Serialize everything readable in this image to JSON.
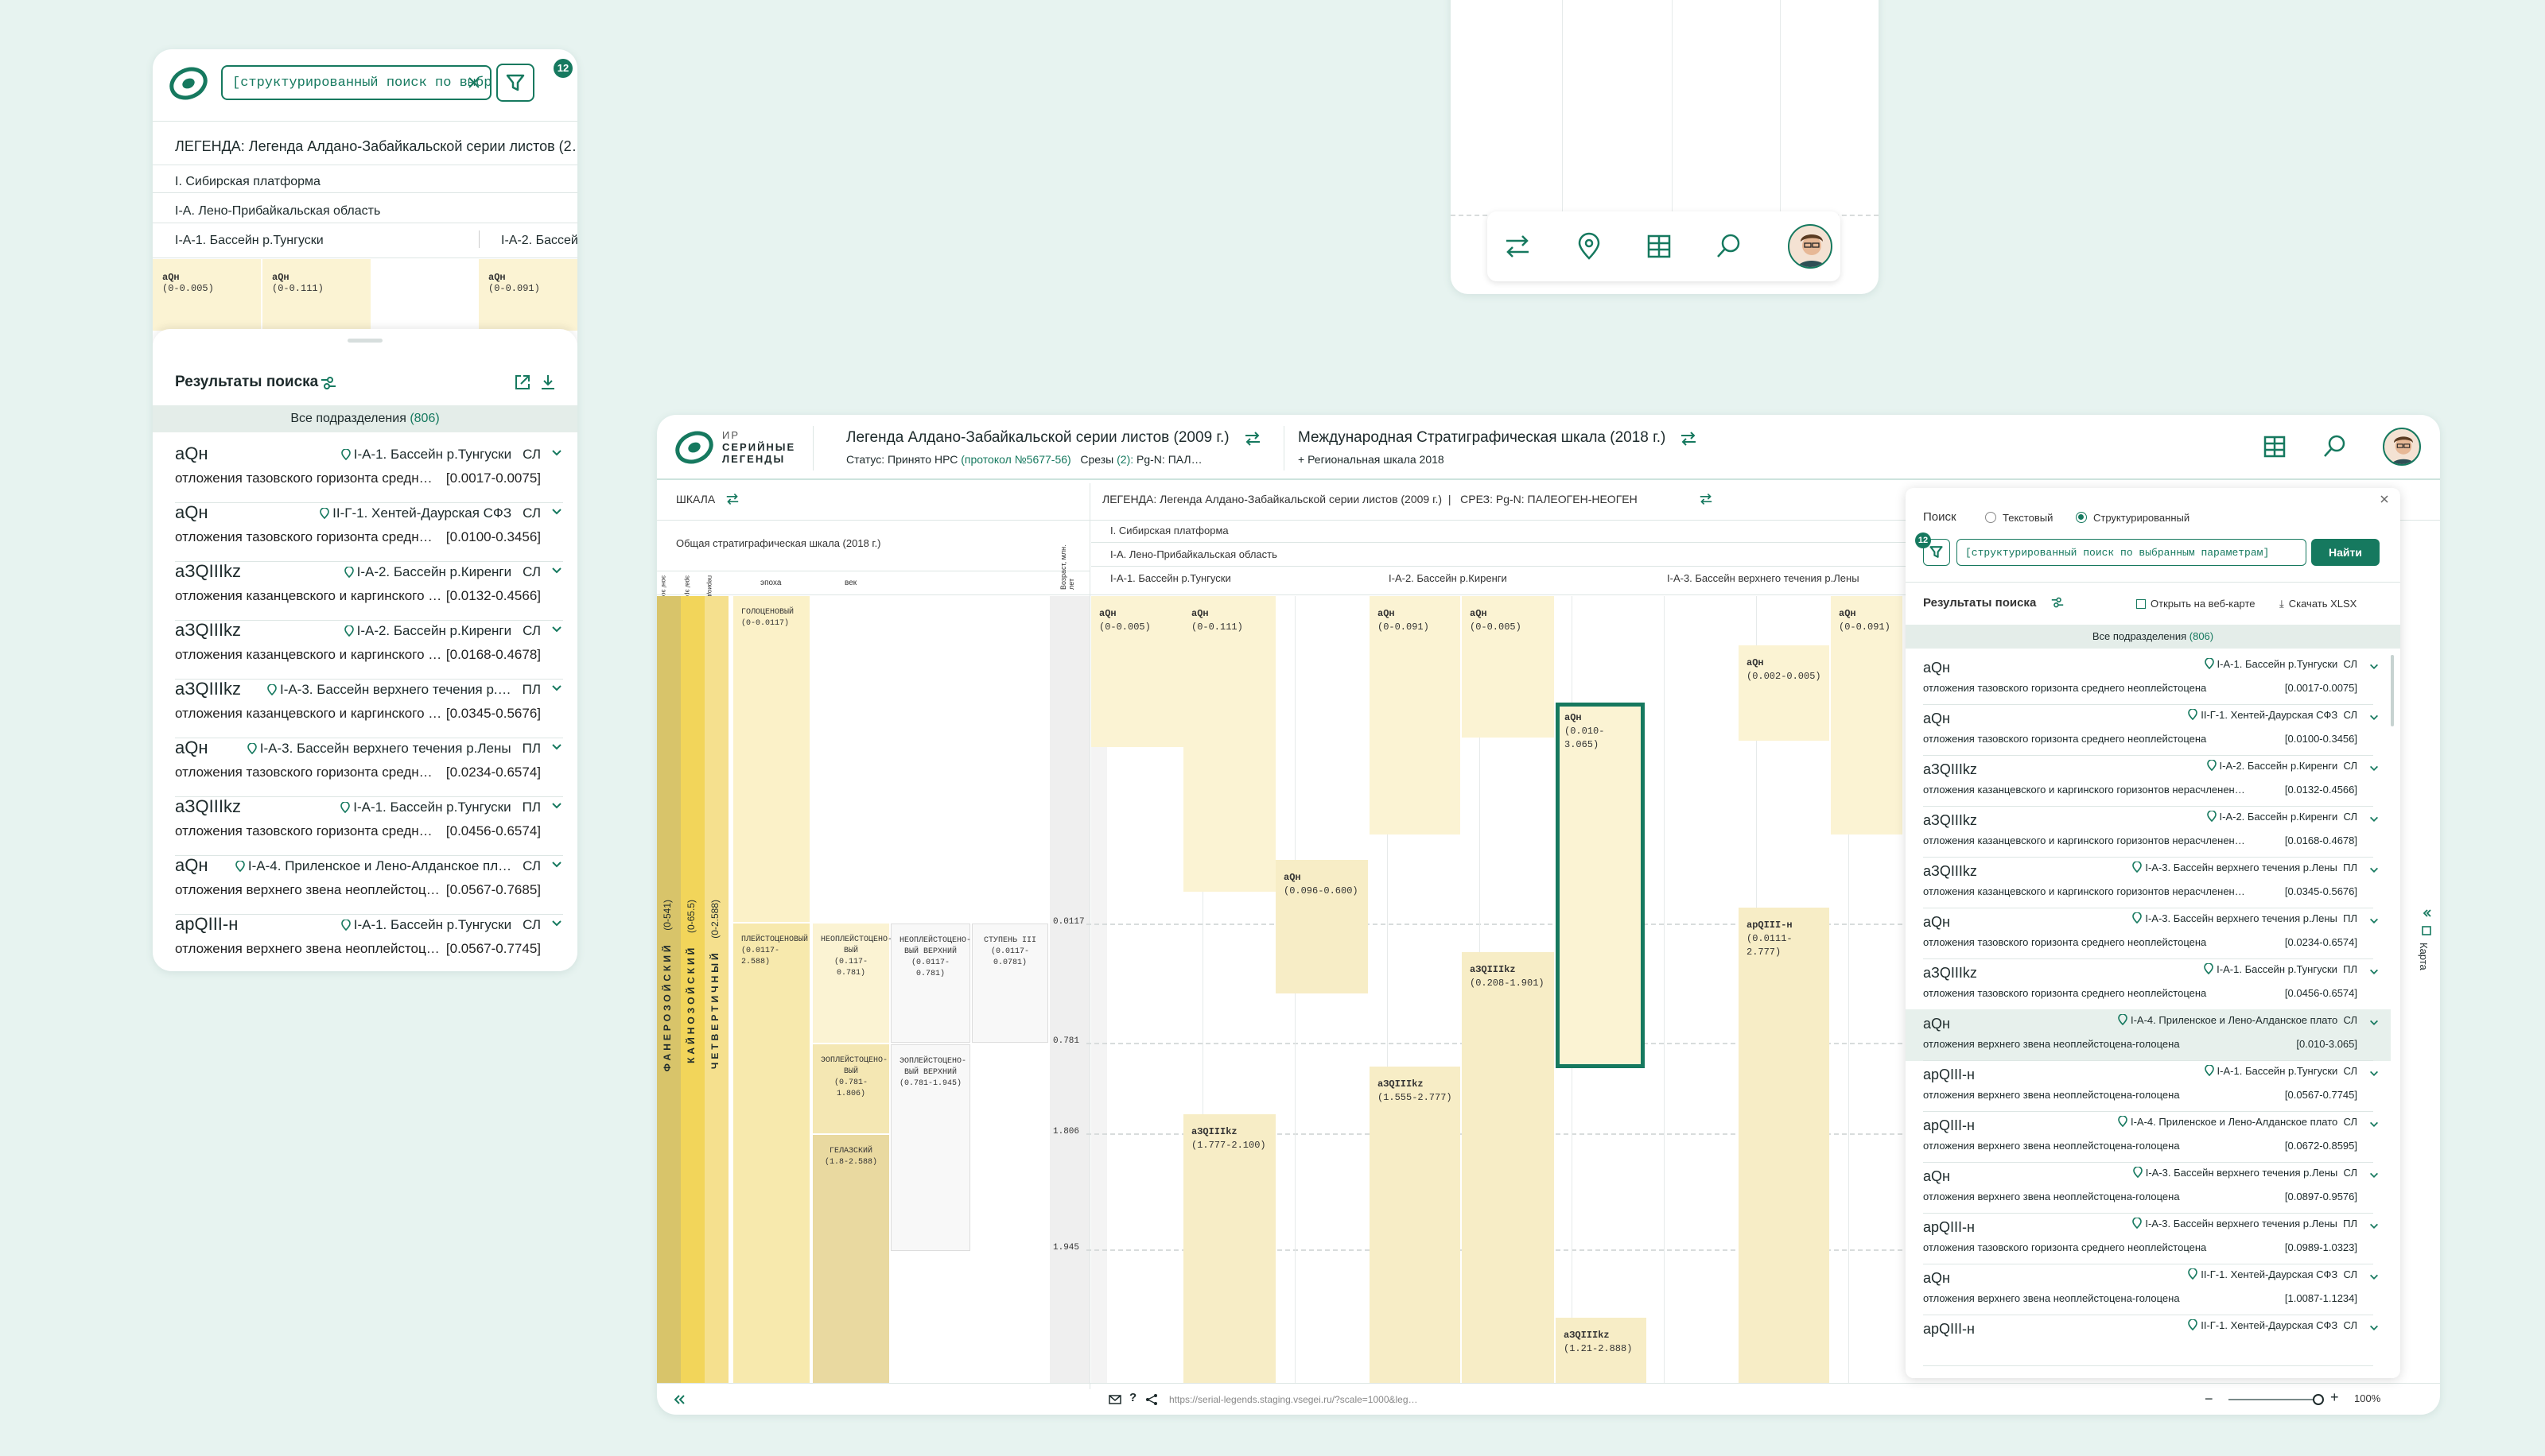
{
  "brand": {
    "line1": "ИР",
    "line2": "СЕРИЙНЫЕ",
    "line3": "ЛЕГЕНДЫ",
    "accent": "#16795f",
    "bg": "#e7f3f0",
    "cell": "#fbf3d3"
  },
  "mobile": {
    "search_value": "[структурированный поиск по выбр…",
    "filter_badge": "12",
    "legend_prefix": "ЛЕГЕНДА:",
    "legend_title": "Легенда Алдано-Забайкальской серии листов (2…",
    "region_1": "I. Сибирская платформа",
    "region_2": "I-А. Лено-Прибайкальская область",
    "basin_1": "I-А-1. Бассейн р.Тунгуски",
    "basin_2": "I-А-2. Бассей",
    "cells": [
      {
        "code": "aQн",
        "range": "(0-0.005)"
      },
      {
        "code": "aQн",
        "range": "(0-0.111)"
      },
      {
        "code": "aQн",
        "range": "(0-0.091)"
      }
    ],
    "results_title": "Результаты поиска",
    "all_units_label": "Все подразделения",
    "all_units_count": "(806)",
    "results": [
      {
        "code": "aQн",
        "loc": "I-А-1. Бассейн р.Тунгуски",
        "type": "СЛ",
        "desc": "отложения тазовского горизонта средн…",
        "range": "[0.0017-0.0075]"
      },
      {
        "code": "aQн",
        "loc": "II-Г-1. Хентей-Даурская СФЗ",
        "type": "СЛ",
        "desc": "отложения тазовского горизонта средн…",
        "range": "[0.0100-0.3456]"
      },
      {
        "code": "aЗQIIIkz",
        "loc": "I-А-2. Бассейн р.Киренги",
        "type": "СЛ",
        "desc": "отложения казанцевского и каргинского г…",
        "range": "[0.0132-0.4566]"
      },
      {
        "code": "aЗQIIIkz",
        "loc": "I-А-2. Бассейн р.Киренги",
        "type": "СЛ",
        "desc": "отложения казанцевского и каргинского г…",
        "range": "[0.0168-0.4678]"
      },
      {
        "code": "aЗQIIIkz",
        "loc": "I-А-3. Бассейн верхнего течения р.…",
        "type": "ПЛ",
        "desc": "отложения казанцевского и каргинского г…",
        "range": "[0.0345-0.5676]"
      },
      {
        "code": "aQн",
        "loc": "I-А-3. Бассейн верхнего течения р.Лены",
        "type": "ПЛ",
        "desc": "отложения тазовского горизонта средн…",
        "range": "[0.0234-0.6574]"
      },
      {
        "code": "aЗQIIIkz",
        "loc": "I-А-1. Бассейн р.Тунгуски",
        "type": "ПЛ",
        "desc": "отложения тазовского горизонта средн…",
        "range": "[0.0456-0.6574]"
      },
      {
        "code": "aQн",
        "loc": "I-А-4. Приленское и Лено-Алданское пл…",
        "type": "СЛ",
        "desc": "отложения верхнего звена неоплейстоц…",
        "range": "[0.0567-0.7685]"
      },
      {
        "code": "apQIII-н",
        "loc": "I-А-1. Бассейн р.Тунгуски",
        "type": "СЛ",
        "desc": "отложения верхнего звена неоплейстоц…",
        "range": "[0.0567-0.7745]"
      }
    ]
  },
  "desktop": {
    "legend_title": "Легенда Алдано-Забайкальской серии листов (2009 г.)",
    "status_label": "Статус:",
    "status_value": "Принято НРС",
    "protocol": "(протокол №5677-56)",
    "slices_label": "Срезы",
    "slices_count": "(2):",
    "slices_value": "Pg-N: ПАЛ…",
    "scale_title": "Международная Стратиграфическая шкала (2018 г.)",
    "scale_sub": "+ Региональная шкала 2018",
    "scale_label": "ШКАЛА",
    "legend_label": "ЛЕГЕНДА:",
    "legend_name": "Легенда Алдано-Забайкальской серии листов (2009 г.)",
    "slice_label": "СРЕЗ:",
    "slice_value": "Pg-N: ПАЛЕОГЕН-НЕОГЕН",
    "scale_name": "Общая стратиграфическая шкала (2018 г.)",
    "scale_heads": [
      "эон/ эонотема",
      "эра/ эратема",
      "период/ система",
      "эпоха",
      "век"
    ],
    "age_head": "Возраст, млн. лет",
    "region_1": "I. Сибирская платформа",
    "region_2": "I-А. Лено-Прибайкальская область",
    "basins": [
      "I-А-1. Бассейн р.Тунгуски",
      "I-А-2. Бассейн р.Киренги",
      "I-А-3. Бассейн верхнего течения р.Лены"
    ],
    "eon": "ФАНЕРОЗОЙСКИЙ",
    "eon_range": "(0-541)",
    "era": "КАЙНОЗОЙСКИЙ",
    "era_range": "(0-65.5)",
    "period": "ЧЕТВЕРТИЧНЫЙ",
    "period_range": "(0-2.588)",
    "epochs": [
      {
        "name": "ГОЛОЦЕНОВЫЙ",
        "range": "(0-0.0117)"
      },
      {
        "name": "ПЛЕЙСТОЦЕНОВЫЙ",
        "range": "(0.0117-2.588)"
      }
    ],
    "ages": [
      {
        "name": "НЕОПЛЕЙСТОЦЕНО-ВЫЙ",
        "range": "(0.117-0.781)"
      },
      {
        "name": "НЕОПЛЕЙСТОЦЕНО-ВЫЙ ВЕРХНИЙ",
        "range": "(0.0117-0.781)"
      },
      {
        "name": "СТУПЕНЬ III",
        "range": "(0.0117-0.0781)"
      },
      {
        "name": "ЭОПЛЕЙСТОЦЕНО-ВЫЙ",
        "range": "(0.781-1.806)"
      },
      {
        "name": "ЭОПЛЕЙСТОЦЕНО-ВЫЙ ВЕРХНИЙ",
        "range": "(0.781-1.945)"
      },
      {
        "name": "ГЕЛАЗСКИЙ",
        "range": "(1.8-2.588)"
      }
    ],
    "ticks": [
      "0.0117",
      "0.781",
      "1.806",
      "1.945"
    ],
    "units": [
      {
        "code": "aQн",
        "range": "(0-0.005)"
      },
      {
        "code": "aQн",
        "range": "(0-0.111)"
      },
      {
        "code": "aQн",
        "range": "(0.096-0.600)"
      },
      {
        "code": "aQн",
        "range": "(0-0.091)"
      },
      {
        "code": "aQн",
        "range": "(0-0.005)"
      },
      {
        "code": "aQн",
        "range": "(0.010-3.065)"
      },
      {
        "code": "aQн",
        "range": "(0.002-0.005)"
      },
      {
        "code": "aQн",
        "range": "(0-0.091)"
      },
      {
        "code": "aЗQIIIkz",
        "range": "(1.777-2.100)"
      },
      {
        "code": "aЗQIIIkz",
        "range": "(1.555-2.777)"
      },
      {
        "code": "aЗQIIIkz",
        "range": "(0.208-1.901)"
      },
      {
        "code": "aЗQIIIkz",
        "range": "(1.21-2.888)"
      },
      {
        "code": "apQIII-н",
        "range": "(0.0111-2.777)"
      }
    ],
    "footer_url": "https://serial-legends.staging.vsegei.ru/?scale=1000&leg…",
    "zoom": "100%",
    "map_label": "Карта",
    "search": {
      "title": "Поиск",
      "opt_text": "Текстовый",
      "opt_struct": "Структурированный",
      "value": "[структурированный поиск по выбранным параметрам]",
      "badge": "12",
      "find": "Найти",
      "results_title": "Результаты поиска",
      "open_web": "Открыть на веб-карте",
      "download": "Скачать XLSX",
      "all_units_label": "Все подразделения",
      "all_units_count": "(806)",
      "results": [
        {
          "code": "aQн",
          "loc": "I-А-1. Бассейн р.Тунгуски",
          "type": "СЛ",
          "desc": "отложения тазовского горизонта среднего неоплейстоцена",
          "range": "[0.0017-0.0075]"
        },
        {
          "code": "aQн",
          "loc": "II-Г-1. Хентей-Даурская СФЗ",
          "type": "СЛ",
          "desc": "отложения тазовского горизонта среднего неоплейстоцена",
          "range": "[0.0100-0.3456]"
        },
        {
          "code": "aЗQIIIkz",
          "loc": "I-А-2. Бассейн р.Киренги",
          "type": "СЛ",
          "desc": "отложения казанцевского и каргинского горизонтов нерасчленен…",
          "range": "[0.0132-0.4566]"
        },
        {
          "code": "aЗQIIIkz",
          "loc": "I-А-2. Бассейн р.Киренги",
          "type": "СЛ",
          "desc": "отложения казанцевского и каргинского горизонтов нерасчленен…",
          "range": "[0.0168-0.4678]"
        },
        {
          "code": "aЗQIIIkz",
          "loc": "I-А-3. Бассейн верхнего течения р.Лены",
          "type": "ПЛ",
          "desc": "отложения казанцевского и каргинского горизонтов нерасчленен…",
          "range": "[0.0345-0.5676]"
        },
        {
          "code": "aQн",
          "loc": "I-А-3. Бассейн верхнего течения р.Лены",
          "type": "ПЛ",
          "desc": "отложения тазовского горизонта среднего неоплейстоцена",
          "range": "[0.0234-0.6574]"
        },
        {
          "code": "aЗQIIIkz",
          "loc": "I-А-1. Бассейн р.Тунгуски",
          "type": "ПЛ",
          "desc": "отложения тазовского горизонта среднего неоплейстоцена",
          "range": "[0.0456-0.6574]"
        },
        {
          "code": "aQн",
          "loc": "I-А-4. Приленское и Лено-Алданское плато",
          "type": "СЛ",
          "desc": "отложения верхнего звена неоплейстоцена-голоцена",
          "range": "[0.010-3.065]"
        },
        {
          "code": "apQIII-н",
          "loc": "I-А-1. Бассейн р.Тунгуски",
          "type": "СЛ",
          "desc": "отложения верхнего звена неоплейстоцена-голоцена",
          "range": "[0.0567-0.7745]"
        },
        {
          "code": "apQIII-н",
          "loc": "I-А-4. Приленское и Лено-Алданское плато",
          "type": "СЛ",
          "desc": "отложения верхнего звена неоплейстоцена-голоцена",
          "range": "[0.0672-0.8595]"
        },
        {
          "code": "aQн",
          "loc": "I-А-3. Бассейн верхнего течения р.Лены",
          "type": "СЛ",
          "desc": "отложения верхнего звена неоплейстоцена-голоцена",
          "range": "[0.0897-0.9576]"
        },
        {
          "code": "apQIII-н",
          "loc": "I-А-3. Бассейн верхнего течения р.Лены",
          "type": "ПЛ",
          "desc": "отложения тазовского горизонта среднего неоплейстоцена",
          "range": "[0.0989-1.0323]"
        },
        {
          "code": "aQн",
          "loc": "II-Г-1. Хентей-Даурская СФЗ",
          "type": "СЛ",
          "desc": "отложения верхнего звена неоплейстоцена-голоцена",
          "range": "[1.0087-1.1234]"
        },
        {
          "code": "apQIII-н",
          "loc": "II-Г-1. Хентей-Даурская СФЗ",
          "type": "СЛ",
          "desc": "",
          "range": ""
        }
      ]
    }
  }
}
